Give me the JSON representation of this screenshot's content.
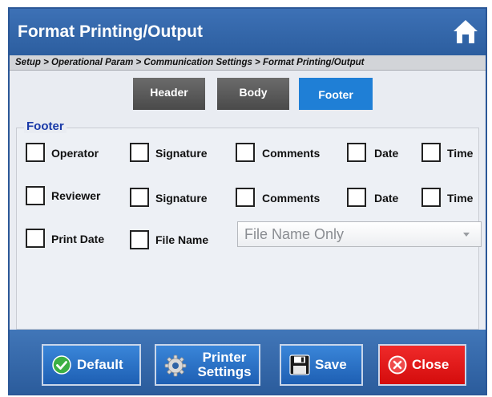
{
  "window": {
    "title": "Format Printing/Output"
  },
  "breadcrumb": "Setup > Operational Param > Communication Settings > Format Printing/Output",
  "tabs": [
    {
      "label": "Header",
      "active": false
    },
    {
      "label": "Body",
      "active": false
    },
    {
      "label": "Footer",
      "active": true
    }
  ],
  "footer_section": {
    "legend": "Footer",
    "row1": [
      "Operator",
      "Signature",
      "Comments",
      "Date",
      "Time"
    ],
    "row2": [
      "Reviewer",
      "Signature",
      "Comments",
      "Date",
      "Time"
    ],
    "row3": [
      "Print Date",
      "File Name"
    ],
    "file_name_option": "File Name Only"
  },
  "buttons": {
    "default": "Default",
    "printer_settings_line1": "Printer",
    "printer_settings_line2": "Settings",
    "save": "Save",
    "close": "Close"
  },
  "colors": {
    "titlebar": "#2f63a6",
    "tab_active": "#1f7fd6",
    "tab_inactive": "#595959",
    "close_button": "#e01414",
    "legend_text": "#1a3aa8"
  }
}
